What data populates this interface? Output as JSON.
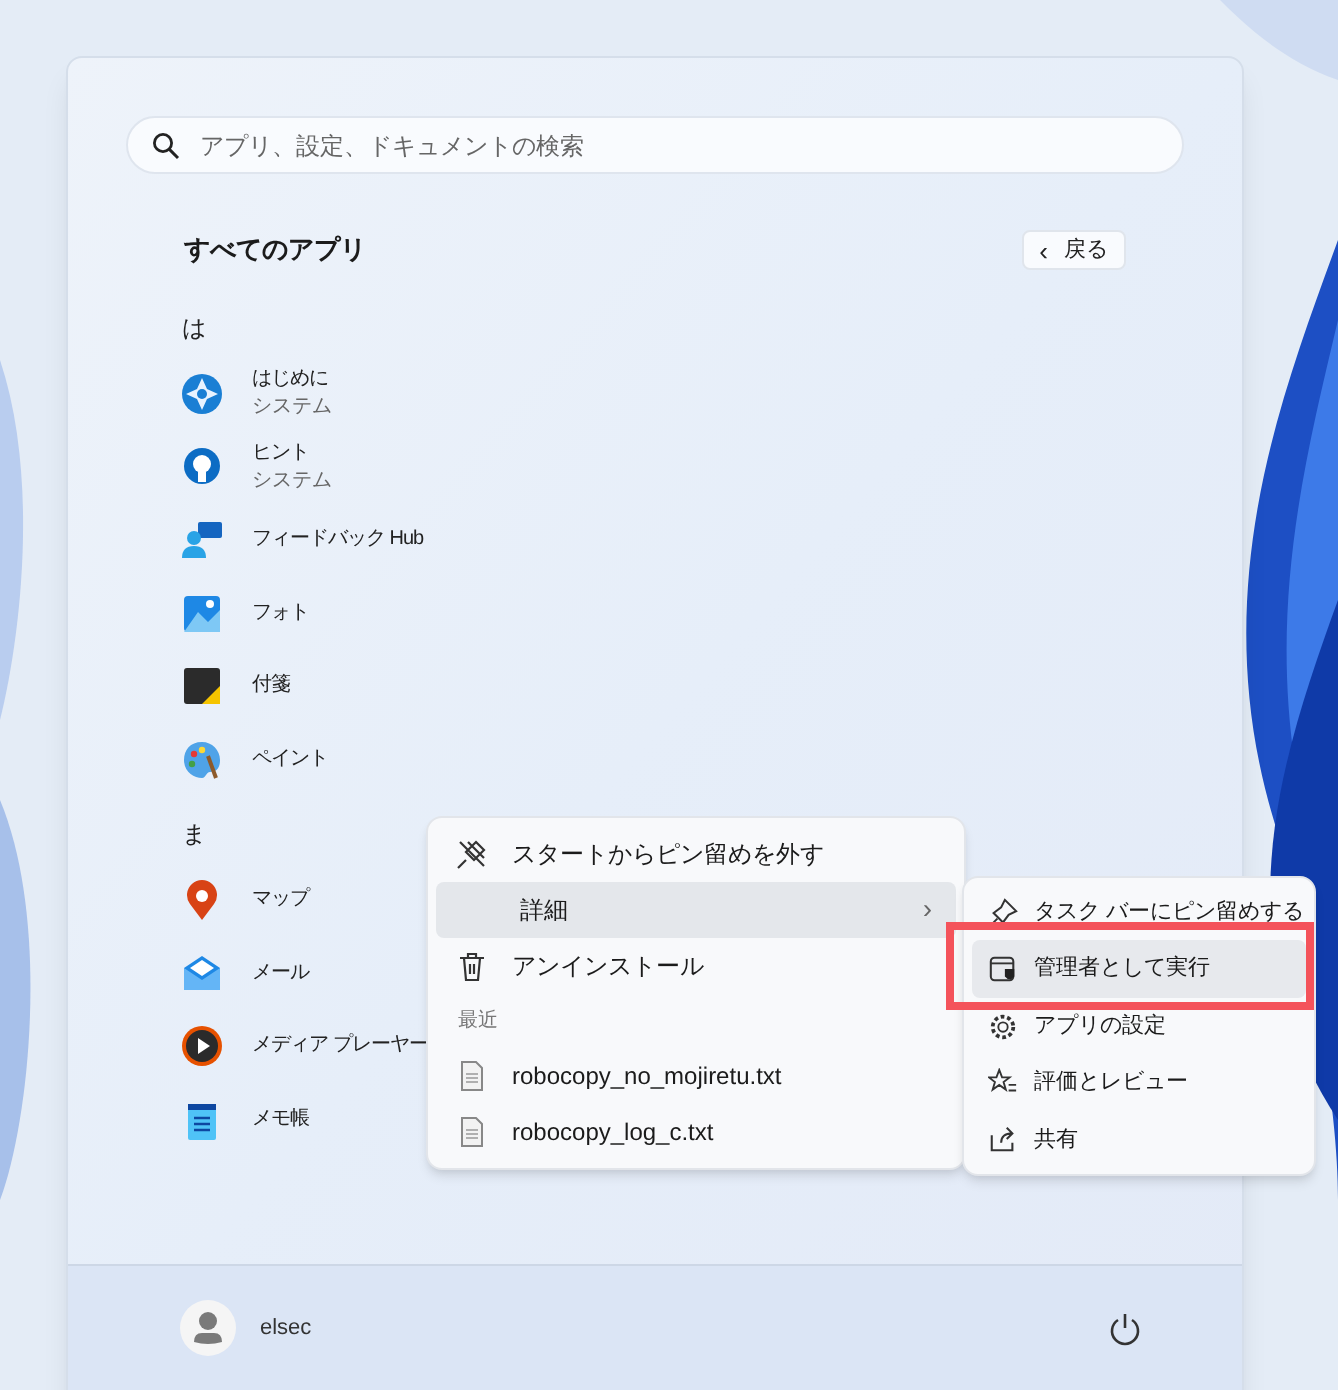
{
  "search": {
    "placeholder": "アプリ、設定、ドキュメントの検索"
  },
  "heading": "すべてのアプリ",
  "back_button": {
    "chevron": "‹",
    "label": "戻る"
  },
  "app_groups": [
    {
      "letter": "は",
      "apps": [
        {
          "name": "はじめに",
          "subtitle": "システム"
        },
        {
          "name": "ヒント",
          "subtitle": "システム"
        },
        {
          "name": "フィードバック Hub"
        },
        {
          "name": "フォト"
        },
        {
          "name": "付箋"
        },
        {
          "name": "ペイント"
        }
      ]
    },
    {
      "letter": "ま",
      "apps": [
        {
          "name": "マップ"
        },
        {
          "name": "メール"
        },
        {
          "name": "メディア プレーヤー"
        },
        {
          "name": "メモ帳"
        }
      ]
    }
  ],
  "context_menu": {
    "items": [
      {
        "kind": "action",
        "label": "スタートからピン留めを外す",
        "selected": false
      },
      {
        "kind": "submenu",
        "label": "詳細",
        "chevron": "›",
        "selected": true
      },
      {
        "kind": "action",
        "label": "アンインストール",
        "selected": false
      },
      {
        "kind": "section",
        "label": "最近",
        "selected": false
      },
      {
        "kind": "file",
        "label": "robocopy_no_mojiretu.txt",
        "selected": false
      },
      {
        "kind": "file",
        "label": "robocopy_log_c.txt",
        "selected": false
      }
    ]
  },
  "submenu": {
    "items": [
      {
        "label": "タスク バーにピン留めする",
        "selected": false
      },
      {
        "label": "管理者として実行",
        "selected": true
      },
      {
        "label": "アプリの設定",
        "selected": false
      },
      {
        "label": "評価とレビュー",
        "selected": false
      },
      {
        "label": "共有",
        "selected": false
      }
    ]
  },
  "user": {
    "name": "elsec"
  }
}
